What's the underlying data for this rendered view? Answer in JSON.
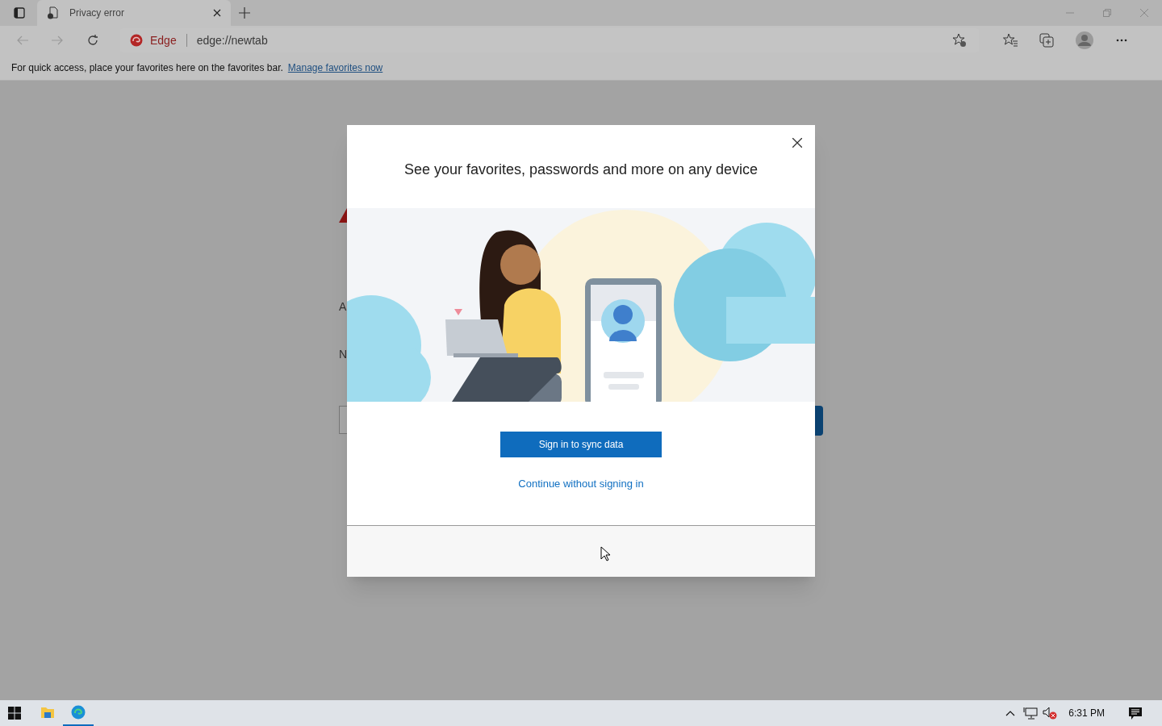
{
  "browser": {
    "tab": {
      "title": "Privacy error"
    },
    "address": {
      "site_label": "Edge",
      "url": "edge://newtab"
    },
    "favorites_bar": {
      "message": "For quick access, place your favorites here on the favorites bar.",
      "link": "Manage favorites now"
    }
  },
  "background_page": {
    "texts": [
      "A",
      "N"
    ]
  },
  "dialog": {
    "title": "See your favorites, passwords and more on any device",
    "primary_button": "Sign in to sync data",
    "link": "Continue without signing in"
  },
  "taskbar": {
    "apps": [
      {
        "kind": "explorer",
        "selected": false
      },
      {
        "kind": "edge",
        "selected": true
      }
    ],
    "clock": "6:31 PM"
  }
}
